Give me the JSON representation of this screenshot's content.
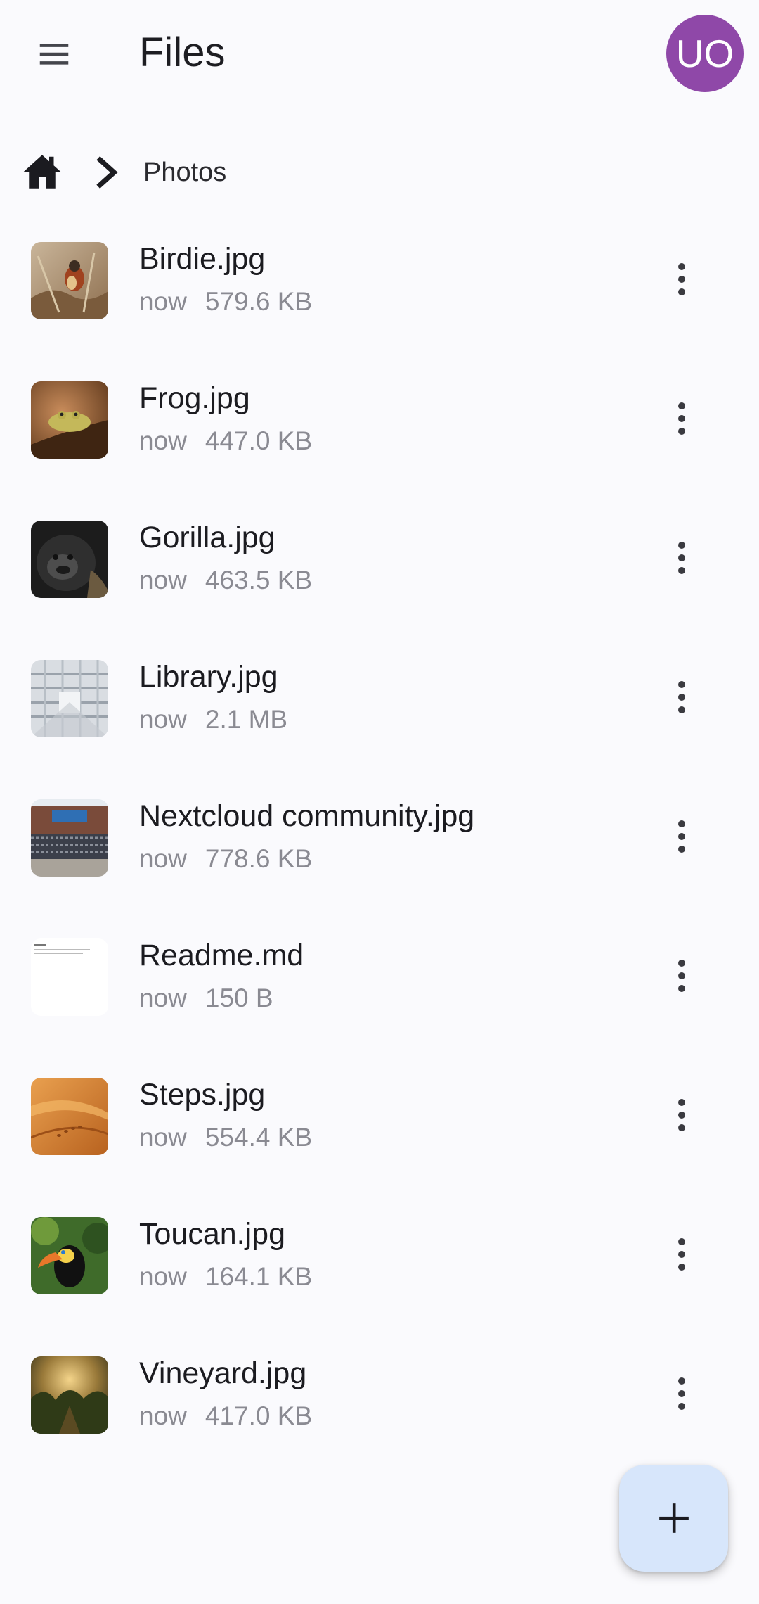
{
  "app_bar": {
    "title": "Files",
    "menu_icon": "hamburger-menu-icon",
    "avatar_initials": "UO",
    "avatar_color": "#8f48a8"
  },
  "breadcrumb": {
    "home_icon": "home-icon",
    "separator_icon": "chevron-right-icon",
    "current": "Photos"
  },
  "files": [
    {
      "name": "Birdie.jpg",
      "modified": "now",
      "size": "579.6 KB"
    },
    {
      "name": "Frog.jpg",
      "modified": "now",
      "size": "447.0 KB"
    },
    {
      "name": "Gorilla.jpg",
      "modified": "now",
      "size": "463.5 KB"
    },
    {
      "name": "Library.jpg",
      "modified": "now",
      "size": "2.1 MB"
    },
    {
      "name": "Nextcloud community.jpg",
      "modified": "now",
      "size": "778.6 KB"
    },
    {
      "name": "Readme.md",
      "modified": "now",
      "size": "150 B"
    },
    {
      "name": "Steps.jpg",
      "modified": "now",
      "size": "554.4 KB"
    },
    {
      "name": "Toucan.jpg",
      "modified": "now",
      "size": "164.1 KB"
    },
    {
      "name": "Vineyard.jpg",
      "modified": "now",
      "size": "417.0 KB"
    }
  ],
  "row_action_icon": "more-vertical-icon",
  "fab": {
    "icon": "plus-icon",
    "background": "#d7e6fb"
  }
}
